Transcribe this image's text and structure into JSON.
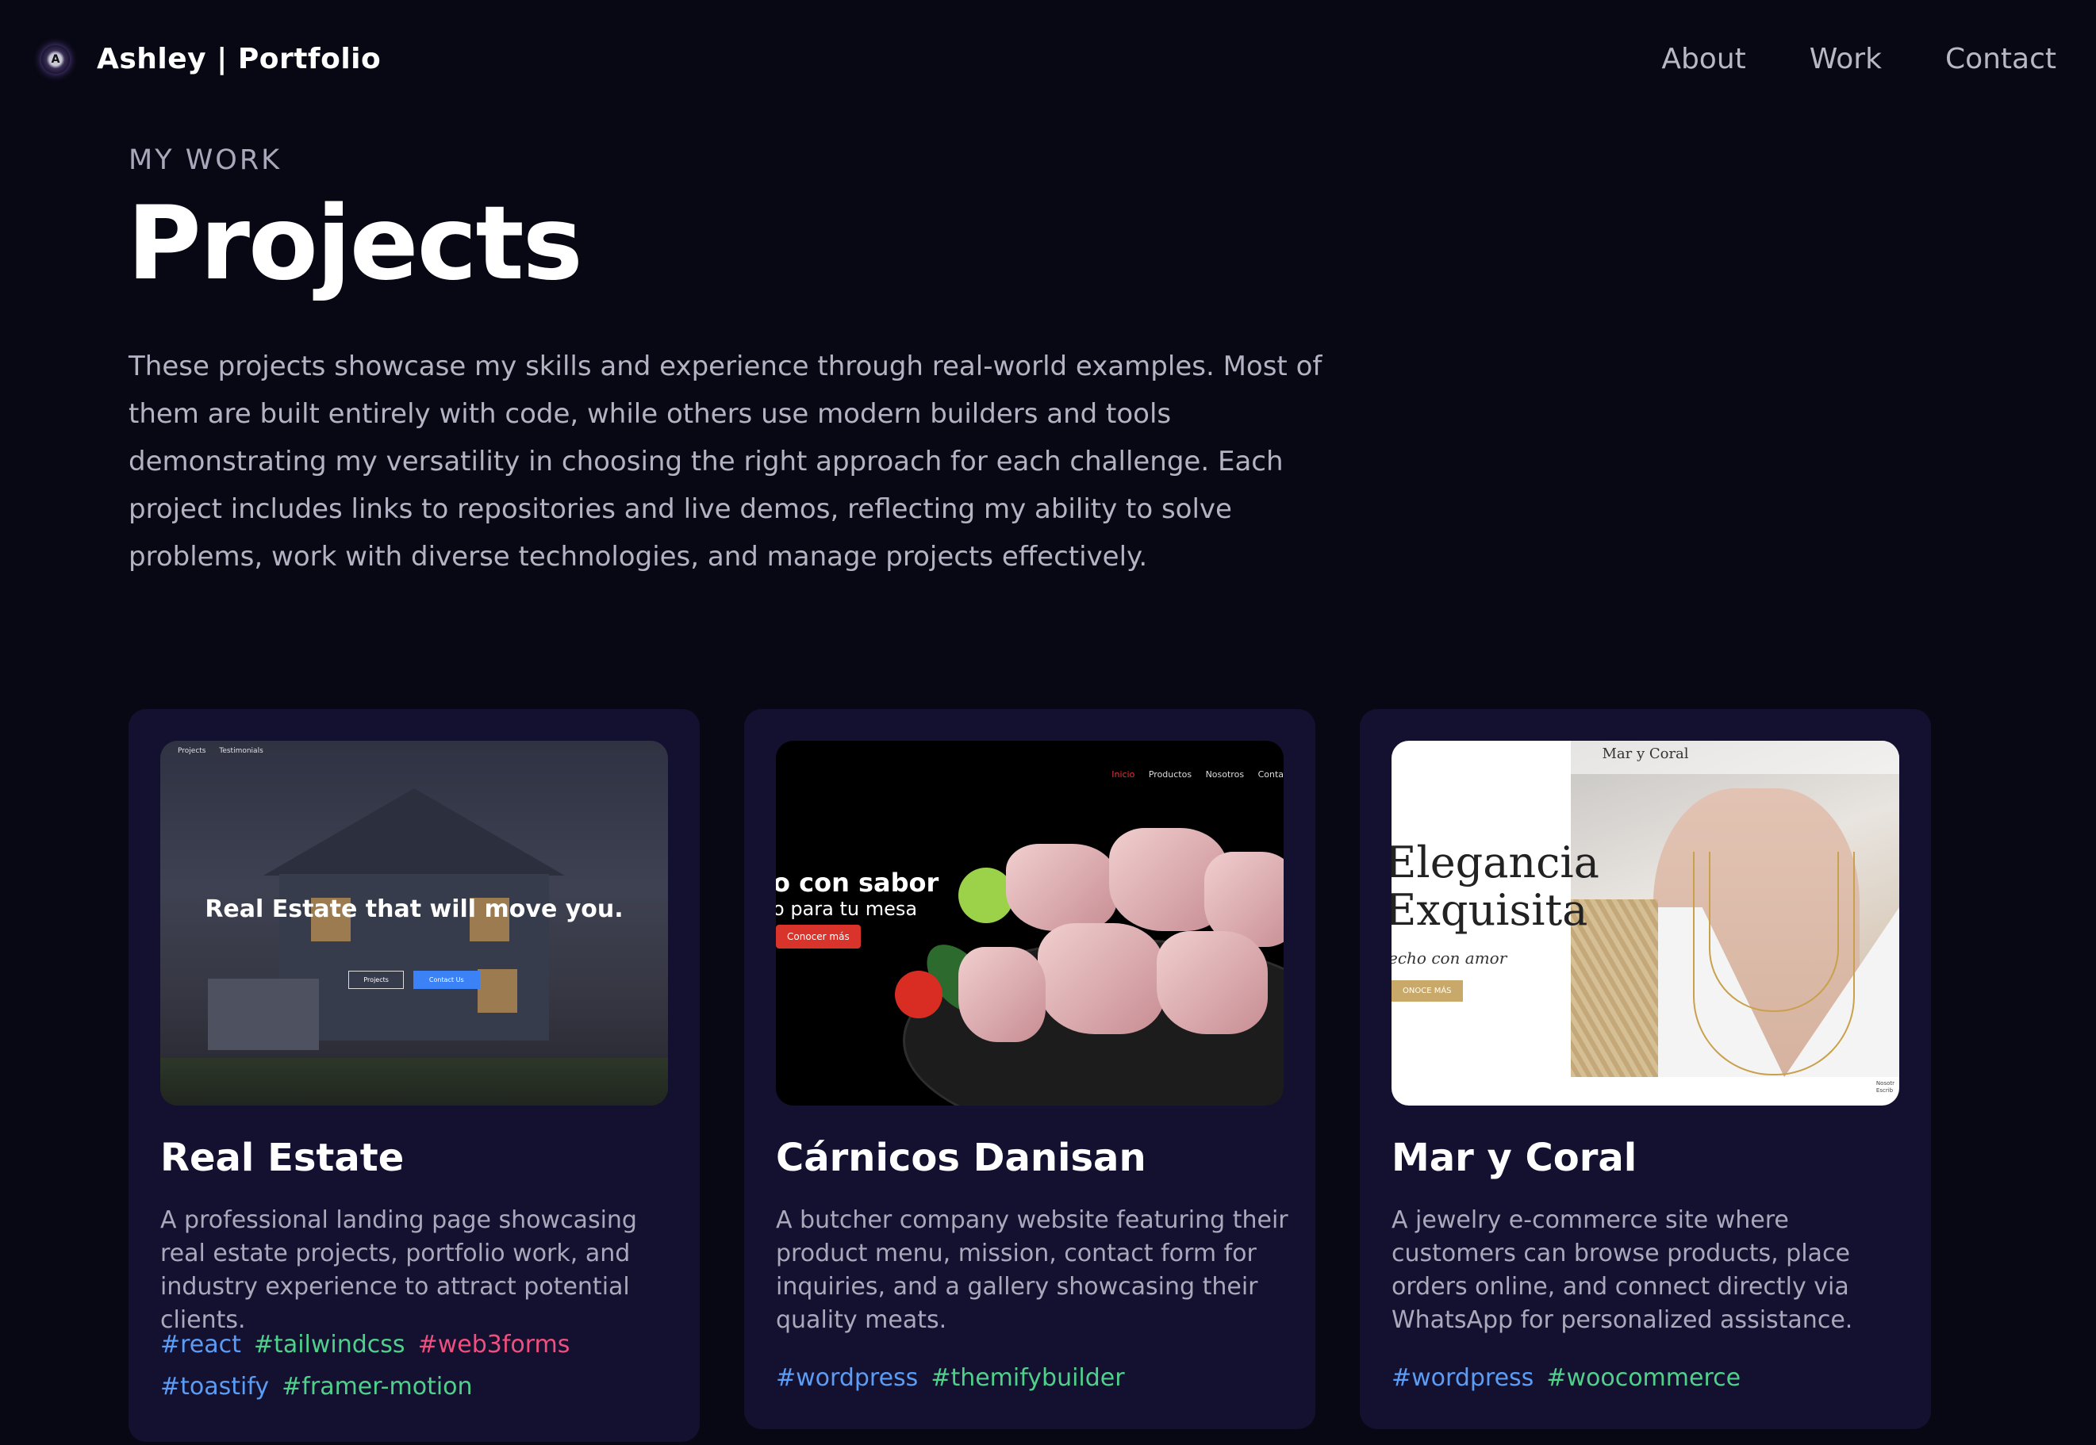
{
  "header": {
    "logo_initial": "A",
    "brand": "Ashley | Portfolio",
    "nav": [
      "About",
      "Work",
      "Contact"
    ]
  },
  "section": {
    "eyebrow": "MY WORK",
    "title": "Projects",
    "intro": "These projects showcase my skills and experience through real-world examples. Most of them are built entirely with code, while others use modern builders and tools demonstrating my versatility in choosing the right approach for each challenge. Each project includes links to repositories and live demos, reflecting my ability to solve problems, work with diverse technologies, and manage projects effectively."
  },
  "projects": [
    {
      "title": "Real Estate",
      "description": "A professional landing page showcasing real estate projects, portfolio work, and industry experience to attract potential clients.",
      "tags": [
        {
          "label": "#react",
          "color": "#5b9cf5"
        },
        {
          "label": "#tailwindcss",
          "color": "#4fd18b"
        },
        {
          "label": "#web3forms",
          "color": "#ef4f7e"
        },
        {
          "label": "#toastify",
          "color": "#5b9cf5"
        },
        {
          "label": "#framer-motion",
          "color": "#4fd18b"
        }
      ],
      "preview": {
        "nav": [
          "Projects",
          "Testimonials"
        ],
        "headline": "Real Estate that will move you.",
        "buttons": [
          "Projects",
          "Contact Us"
        ]
      }
    },
    {
      "title": "Cárnicos Danisan",
      "description": "A butcher company website featuring their product menu, mission, contact form for inquiries, and a gallery showcasing their quality meats.",
      "tags": [
        {
          "label": "#wordpress",
          "color": "#5b9cf5"
        },
        {
          "label": "#themifybuilder",
          "color": "#4fd18b"
        }
      ],
      "preview": {
        "nav": [
          "Inicio",
          "Productos",
          "Nosotros",
          "Conta"
        ],
        "headline": "o con sabor",
        "subline": "o para tu mesa",
        "button": "Conocer más"
      }
    },
    {
      "title": "Mar y Coral",
      "description": "A jewelry e-commerce site where customers can browse products, place orders online, and connect directly via WhatsApp for personalized assistance.",
      "tags": [
        {
          "label": "#wordpress",
          "color": "#5b9cf5"
        },
        {
          "label": "#woocommerce",
          "color": "#4fd18b"
        }
      ],
      "preview": {
        "brand": "Mar y Coral",
        "line1": "Elegancia",
        "line2": "Exquisita",
        "tagline": "echo con amor",
        "button": "ONOCE MÁS",
        "corner": [
          "Nosotr",
          "Escrib"
        ]
      }
    }
  ]
}
